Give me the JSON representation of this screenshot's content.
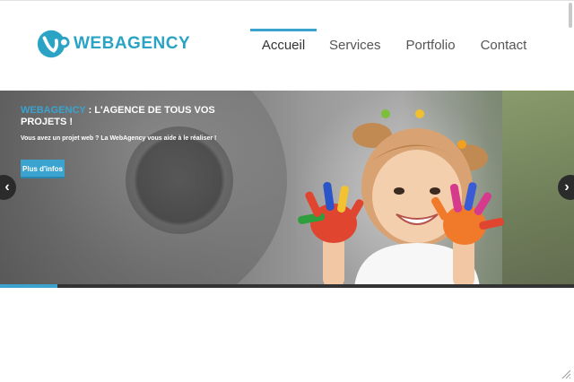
{
  "header": {
    "logo_text": "WEBAGENCY",
    "nav": [
      {
        "label": "Accueil",
        "active": true
      },
      {
        "label": "Services",
        "active": false
      },
      {
        "label": "Portfolio",
        "active": false
      },
      {
        "label": "Contact",
        "active": false
      }
    ]
  },
  "slider": {
    "headline_brand": "WEBAGENCY",
    "headline_rest": " : L'AGENCE DE TOUS VOS PROJETS !",
    "subline": "Vous avez un projet web ? La WebAgency vous aide à le réaliser !",
    "cta_label": "Plus d'infos",
    "prev_icon": "‹",
    "next_icon": "›",
    "progress": 0.1
  },
  "colors": {
    "accent": "#3ba3cf",
    "logo": "#2aa3c4"
  },
  "icons": [
    "logo-mark",
    "chevron-left-icon",
    "chevron-right-icon",
    "resize-handle-icon"
  ]
}
